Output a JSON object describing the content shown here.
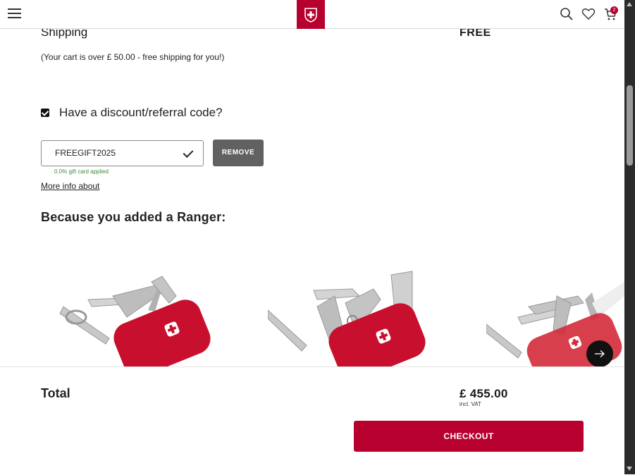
{
  "header": {
    "menu_icon": "hamburger-menu-icon",
    "logo_icon": "swiss-cross-shield-logo",
    "search_icon": "search-icon",
    "wishlist_icon": "heart-icon",
    "cart_icon": "cart-icon",
    "cart_count": "2",
    "brand_color": "#b8002f"
  },
  "shipping": {
    "label": "Shipping",
    "value": "FREE",
    "note": "(Your cart is over £ 50.00 - free shipping for you!)"
  },
  "discount": {
    "checkbox_checked": true,
    "label": "Have a discount/referral code?",
    "code_value": "FREEGIFT2025",
    "remove_label": "REMOVE",
    "applied_note": "0.0% gift card applied",
    "more_info": "More info about"
  },
  "recommendations": {
    "title": "Because you added a Ranger:",
    "next_icon": "arrow-right-icon"
  },
  "summary": {
    "total_label": "Total",
    "total_value": "£ 455.00",
    "vat_note": "incl. VAT",
    "checkout_label": "CHECKOUT"
  }
}
